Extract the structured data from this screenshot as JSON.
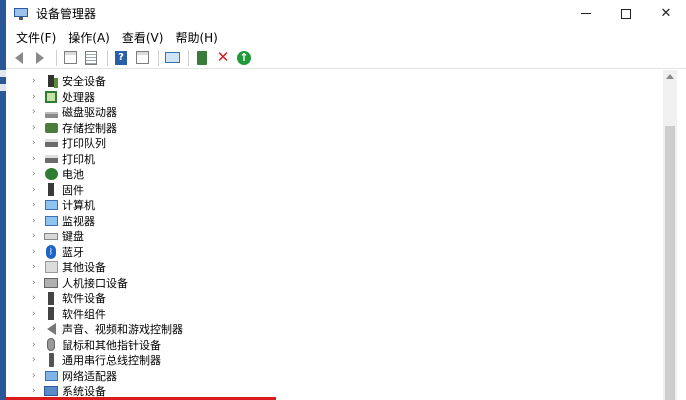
{
  "window": {
    "title": "设备管理器",
    "controls": {
      "minimize": "",
      "maximize": "",
      "close": "✕"
    }
  },
  "menu": [
    "文件(F)",
    "操作(A)",
    "查看(V)",
    "帮助(H)"
  ],
  "toolbar": {
    "icons": [
      "back-arrow-icon",
      "forward-arrow-icon",
      "properties-icon",
      "list-view-icon",
      "help-icon",
      "view-icon",
      "scan-monitor-icon",
      "update-driver-icon",
      "uninstall-icon",
      "enable-device-icon"
    ],
    "help_glyph": "?",
    "uninstall_glyph": "✕",
    "enable_glyph": "↑"
  },
  "tree": {
    "chevron": "›",
    "bt_glyph": "ᛒ",
    "items": [
      {
        "label": "安全设备"
      },
      {
        "label": "处理器"
      },
      {
        "label": "磁盘驱动器"
      },
      {
        "label": "存储控制器"
      },
      {
        "label": "打印队列"
      },
      {
        "label": "打印机"
      },
      {
        "label": "电池"
      },
      {
        "label": "固件"
      },
      {
        "label": "计算机"
      },
      {
        "label": "监视器"
      },
      {
        "label": "键盘"
      },
      {
        "label": "蓝牙"
      },
      {
        "label": "其他设备"
      },
      {
        "label": "人机接口设备"
      },
      {
        "label": "软件设备"
      },
      {
        "label": "软件组件"
      },
      {
        "label": "声音、视频和游戏控制器"
      },
      {
        "label": "鼠标和其他指针设备"
      },
      {
        "label": "通用串行总线控制器"
      },
      {
        "label": "网络适配器"
      },
      {
        "label": "系统设备"
      }
    ]
  },
  "colors": {
    "accent_red": "#d81b1b",
    "taskbar_blue": "#2b5797",
    "enable_green": "#1f9a3a",
    "uninstall_red": "#d21f1f"
  }
}
